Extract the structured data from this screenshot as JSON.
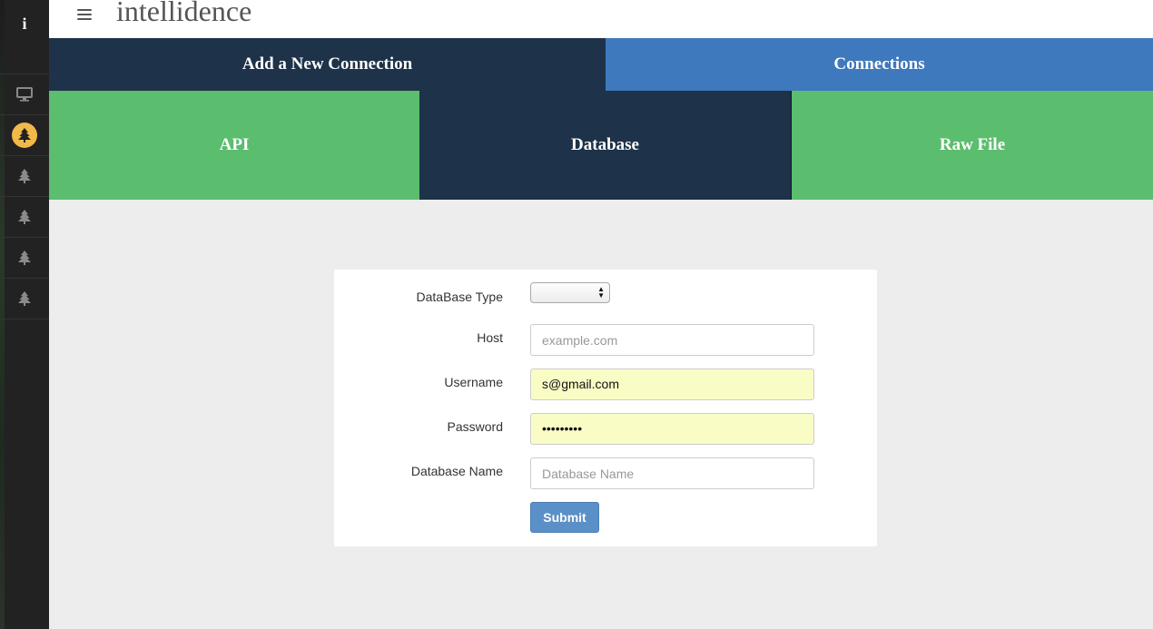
{
  "app": {
    "logo_letter": "i",
    "brand_name": "intellidence"
  },
  "sidebar": {
    "items": [
      {
        "icon": "monitor-icon",
        "active": false
      },
      {
        "icon": "tree-icon",
        "active": true
      },
      {
        "icon": "tree-icon",
        "active": false
      },
      {
        "icon": "tree-icon",
        "active": false
      },
      {
        "icon": "tree-icon",
        "active": false
      },
      {
        "icon": "tree-icon",
        "active": false
      }
    ],
    "active_color": "#f0b949"
  },
  "top_tabs": [
    {
      "label": "Add a New Connection",
      "active": true
    },
    {
      "label": "Connections",
      "active": false
    }
  ],
  "source_tabs": [
    {
      "label": "API",
      "active": false
    },
    {
      "label": "Database",
      "active": true
    },
    {
      "label": "Raw File",
      "active": false
    }
  ],
  "form": {
    "db_type": {
      "label": "DataBase Type",
      "value": ""
    },
    "host": {
      "label": "Host",
      "value": "",
      "placeholder": "example.com"
    },
    "username": {
      "label": "Username",
      "value": "s@gmail.com",
      "placeholder": ""
    },
    "password": {
      "label": "Password",
      "value": "•••••••••",
      "placeholder": ""
    },
    "database_name": {
      "label": "Database Name",
      "value": "",
      "placeholder": "Database Name"
    },
    "submit_label": "Submit"
  },
  "colors": {
    "navy": "#1e3249",
    "blue": "#3e78bd",
    "green": "#5bbd6e",
    "autofill": "#fafcc6",
    "button": "#5b8fc7"
  }
}
